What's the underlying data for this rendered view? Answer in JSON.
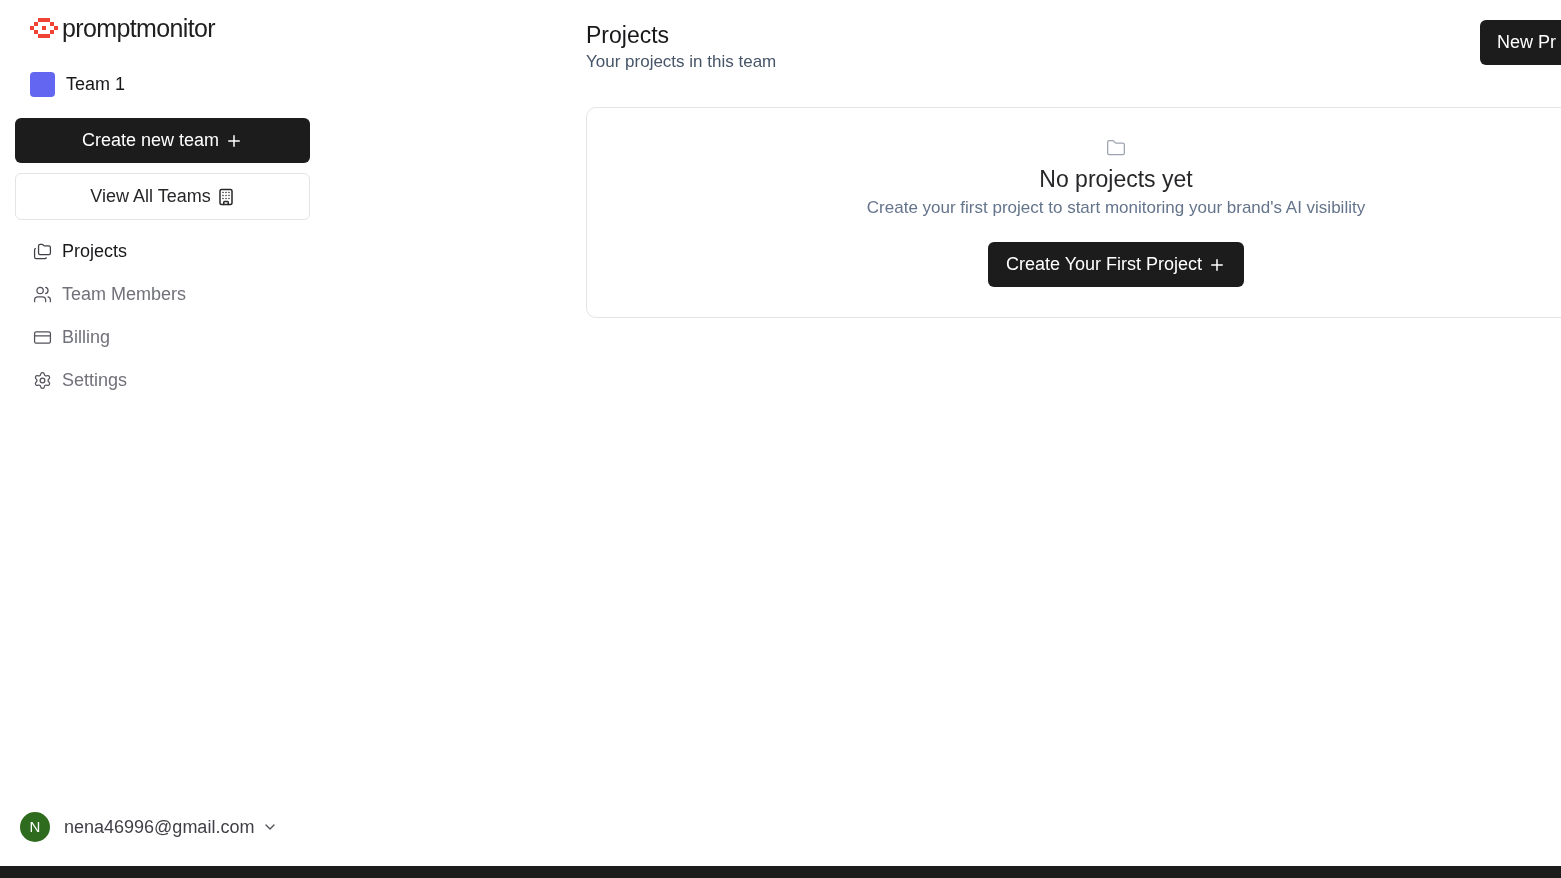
{
  "sidebar": {
    "brand": "promptmonitor",
    "team": {
      "name": "Team 1",
      "color": "#6366f1"
    },
    "create_team_button": "Create new team",
    "view_teams_button": "View All Teams",
    "items": [
      {
        "kind": "projects",
        "label": "Projects",
        "selected": true
      },
      {
        "kind": "members",
        "label": "Team Members",
        "selected": false
      },
      {
        "kind": "billing",
        "label": "Billing",
        "selected": false
      },
      {
        "kind": "settings",
        "label": "Settings",
        "selected": false
      }
    ],
    "user": {
      "initial": "N",
      "email": "nena46996@gmail.com"
    }
  },
  "main": {
    "title": "Projects",
    "subtitle": "Your projects in this team",
    "new_button": "New Pr",
    "empty_state": {
      "title": "No projects yet",
      "text": "Create your first project to start monitoring your brand's AI visibility",
      "button": "Create Your First Project"
    }
  }
}
